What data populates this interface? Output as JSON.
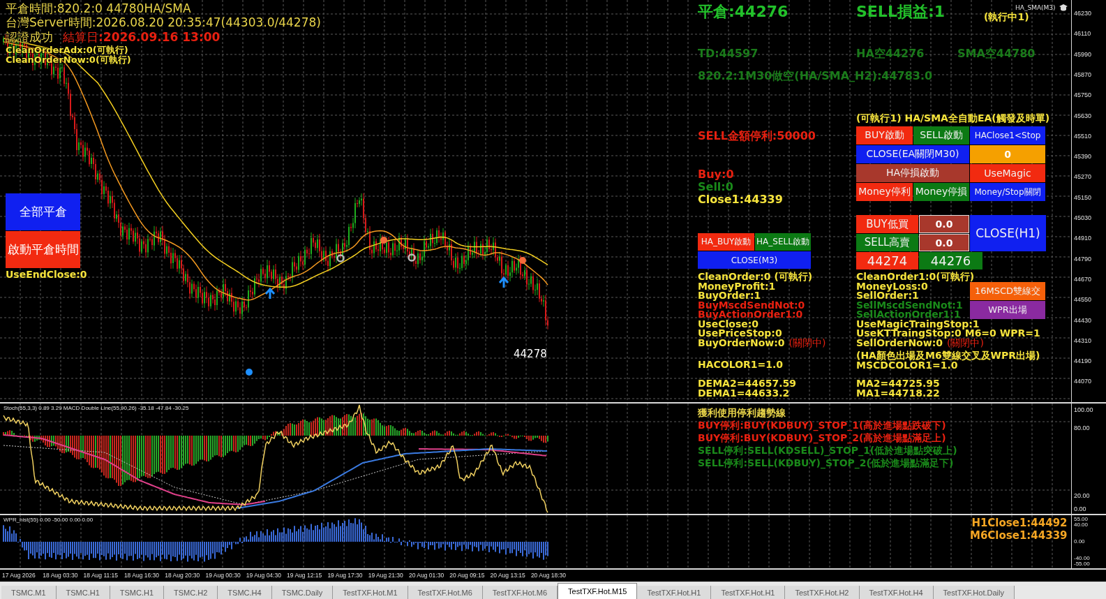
{
  "chart_title": "HA_SMA(M3)",
  "top_left_lines": [
    "平倉時間:820.2:0 44780HA/SMA",
    "台灣Server時間:2026.08.20 20:35:47(44303.0/44278)"
  ],
  "auth_status": "認證成功",
  "settlement": "結算日**:2026.09.16 13:00**",
  "clean_lines": [
    "CleanOrderAdx:0(可執行)",
    "CleanOrderNow:0(可執行)"
  ],
  "left_buttons": [
    {
      "label": "全部平倉",
      "color": "#1020f0"
    },
    {
      "label": "啟動平倉時間",
      "color": "#f22a10"
    }
  ],
  "use_end_close": "UseEndClose:0",
  "last_price": "44278",
  "close_price": "平倉:44276",
  "sell_pnl": "SELL損益:1",
  "running": "(執行中1)",
  "td": "TD:44597",
  "ha_short": "HA空44276",
  "sma_short": "SMA空44780",
  "signal": "820.2:1M30做空(HA/SMA_H2):44783.0",
  "ea_title": "(可執行1)  HA/SMA全自動EA(觸發及時單)",
  "ea_buttons": [
    {
      "label": "BUY啟動",
      "color": "#f22a10"
    },
    {
      "label": "SELL啟動",
      "color": "#0c7a14"
    },
    {
      "label": "HAClose1<Stop",
      "color": "#1020f0"
    },
    {
      "label": "CLOSE(EA關閉M30)",
      "color": "#1020f0"
    },
    {
      "label": "0",
      "color": "#f5a000"
    },
    {
      "label": "HA停損啟動",
      "color": "#a8382c"
    },
    {
      "label": "UseMagic",
      "color": "#f22a10"
    },
    {
      "label": "Money停利",
      "color": "#f22a10"
    },
    {
      "label": "Money停損",
      "color": "#0c7a14"
    },
    {
      "label": "Money/Stop關閉",
      "color": "#1020f0"
    }
  ],
  "sell_money_stop": "SELL金額停利:50000",
  "counts": [
    {
      "text": "Buy:0",
      "color": "#e82010"
    },
    {
      "text": "Sell:0",
      "color": "#1a8a1a"
    },
    {
      "text": "Close1:44339",
      "color": "#f5e33c"
    }
  ],
  "ha_buttons": [
    {
      "label": "HA_BUY啟動",
      "color": "#f22a10"
    },
    {
      "label": "HA_SELL啟動",
      "color": "#0c7a14"
    },
    {
      "label": "CLOSE(M3)",
      "color": "#1020f0"
    }
  ],
  "order_panel": [
    {
      "kind": "button",
      "label": "BUY低買",
      "color": "#f22a10"
    },
    {
      "kind": "field",
      "label": "0.0",
      "color": "#a8382c"
    },
    {
      "kind": "button",
      "label": "CLOSE(H1)",
      "color": "#1020f0"
    },
    {
      "kind": "button",
      "label": "SELL高賣",
      "color": "#0c7a14"
    },
    {
      "kind": "field",
      "label": "0.0",
      "color": "#a8382c"
    },
    {
      "kind": "button",
      "label": "44274",
      "color": "#f22a10"
    },
    {
      "kind": "button",
      "label": "44276",
      "color": "#0c7a14"
    }
  ],
  "left_status": [
    {
      "text": "CleanOrder:0 (可執行)",
      "color": "#f5e33c"
    },
    {
      "text": "MoneyProfit:1",
      "color": "#f5e33c"
    },
    {
      "text": "BuyOrder:1",
      "color": "#f5e33c"
    },
    {
      "text": "BuyMscdSendNot:0",
      "color": "#e82010"
    },
    {
      "text": "BuyActionOrder1:0",
      "color": "#e82010"
    },
    {
      "text": "UseClose:0",
      "color": "#f5e33c"
    },
    {
      "text": "UsePriceStop:0",
      "color": "#f5e33c"
    },
    {
      "text": "BuyOrderNow:0",
      "color": "#f5e33c",
      "note": "(關閉中)"
    }
  ],
  "hacolor": "HACOLOR1=1.0",
  "dema": [
    "DEMA2=44657.59",
    "DEMA1=44633.2"
  ],
  "right_status": [
    {
      "text": "CleanOrder1:0(可執行)",
      "color": "#f5e33c"
    },
    {
      "text": "MoneyLoss:0",
      "color": "#f5e33c"
    },
    {
      "text": "SellOrder:1",
      "color": "#f5e33c"
    },
    {
      "text": "SellMscdSendNot:1",
      "color": "#1a8a1a"
    },
    {
      "text": "SellActionOrder1:1",
      "color": "#1a8a1a"
    },
    {
      "text": "UseMagicTraingStop:1",
      "color": "#f5e33c"
    },
    {
      "text": "UseKTTraingStop:0  M6=0  WPR=1",
      "color": "#f5e33c"
    },
    {
      "text": "SellOrderNow:0",
      "color": "#f5e33c",
      "note": "(關閉中)"
    }
  ],
  "exit_rule": "(HA顏色出場及M6雙線交叉及WPR出場)",
  "mscdcolor": "MSCDCOLOR1=1.0",
  "ma": [
    "MA2=44725.95",
    "MA1=44718.22"
  ],
  "exit_buttons": [
    {
      "label": "16MSCD雙線交",
      "color": "#f5600a"
    },
    {
      "label": "WPR出場",
      "color": "#8a2aa0"
    }
  ],
  "price_axis": [
    "46230",
    "46110",
    "45990",
    "45870",
    "45750",
    "45630",
    "45510",
    "45390",
    "45270",
    "45150",
    "45030",
    "44910",
    "44790",
    "44670",
    "44550",
    "44430",
    "44310",
    "44190",
    "44070"
  ],
  "stoch_title": "Stoch(55,3,3) 0.89 3.29 MACD Double Line(55,90,26) -35.18 -47.84 -30.25",
  "stoch_notes": [
    {
      "text": "獲利使用停利趨勢線",
      "color": "#e8d44a"
    },
    {
      "text": "BUY停利:BUY(KDBUY)_STOP_1(高於進場點跌破下)",
      "color": "#e82010"
    },
    {
      "text": "BUY停利:BUY(KDBUY)_STOP_2(高於進場點滿足上)",
      "color": "#e82010"
    },
    {
      "text": "SELL停利:SELL(KDSELL)_STOP_1(低於進場點突破上)",
      "color": "#1a8a1a"
    },
    {
      "text": "SELL停利:SELL(KDBUY)_STOP_2(低於進場點滿足下)",
      "color": "#1a8a1a"
    }
  ],
  "stoch_axis": [
    "100.00",
    "80.00",
    "20.00",
    "0.00"
  ],
  "wpr_title": "WPR_hist(55) 0.00 -50.00 0.00 0.00",
  "wpr_closes": [
    "H1Close1:44492",
    "M6Close1:44339"
  ],
  "wpr_axis": [
    "55.00",
    "40.00",
    "0.00",
    "-40.00",
    "-55.00"
  ],
  "time_axis": [
    "17 Aug 2026",
    "18 Aug 03:30",
    "18 Aug 11:15",
    "18 Aug 16:30",
    "18 Aug 20:30",
    "19 Aug 00:30",
    "19 Aug 04:30",
    "19 Aug 12:15",
    "19 Aug 17:30",
    "19 Aug 21:30",
    "20 Aug 01:30",
    "20 Aug 09:15",
    "20 Aug 13:15",
    "20 Aug 18:30"
  ],
  "tabs": [
    {
      "label": "TSMC.M1",
      "selected": false
    },
    {
      "label": "TSMC.H1",
      "selected": false
    },
    {
      "label": "TSMC.H1",
      "selected": false
    },
    {
      "label": "TSMC.H2",
      "selected": false
    },
    {
      "label": "TSMC.H4",
      "selected": false
    },
    {
      "label": "TSMC.Daily",
      "selected": false
    },
    {
      "label": "TestTXF.Hot.M1",
      "selected": false
    },
    {
      "label": "TestTXF.Hot.M6",
      "selected": false
    },
    {
      "label": "TestTXF.Hot.M6",
      "selected": false
    },
    {
      "label": "TestTXF.Hot.M15",
      "selected": true
    },
    {
      "label": "TestTXF.Hot.H1",
      "selected": false
    },
    {
      "label": "TestTXF.Hot.H1",
      "selected": false
    },
    {
      "label": "TestTXF.Hot.H2",
      "selected": false
    },
    {
      "label": "TestTXF.Hot.H4",
      "selected": false
    },
    {
      "label": "TestTXF.Hot.Daily",
      "selected": false
    }
  ]
}
